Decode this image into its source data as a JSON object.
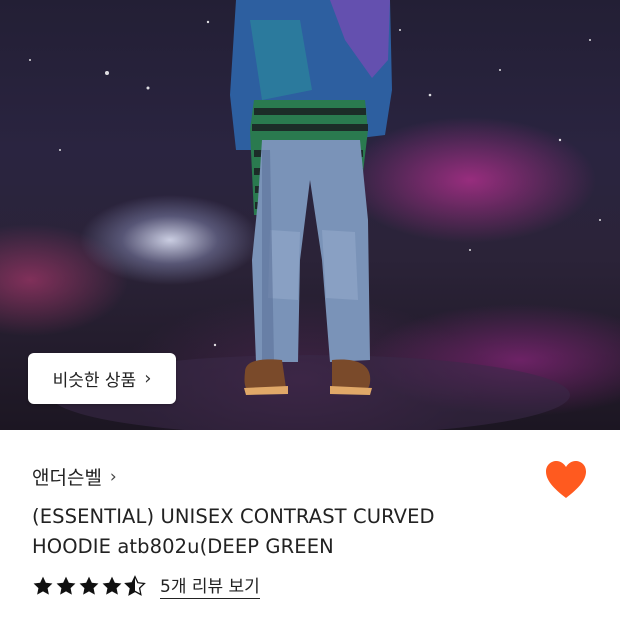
{
  "hero": {
    "image": "product-photo-model-cosmic-background",
    "similar_button": {
      "label": "비슷한 상품",
      "icon": "chevron-right-icon",
      "chevron": "›"
    }
  },
  "product": {
    "brand": "앤더슨벨",
    "brand_chevron": "›",
    "title_line1": "(ESSENTIAL) UNISEX CONTRAST CURVED",
    "title_line2": "HOODIE atb802u(DEEP GREEN",
    "wishlist": {
      "icon": "heart-icon",
      "active": true,
      "color": "#ff5a1f"
    },
    "rating": {
      "value": 4.5,
      "max": 5
    },
    "review_link": "5개 리뷰 보기"
  }
}
